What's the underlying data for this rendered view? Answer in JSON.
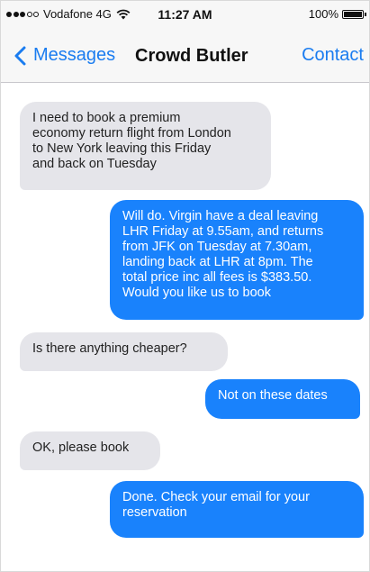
{
  "status_bar": {
    "carrier": "Vodafone 4G",
    "time": "11:27 AM",
    "battery": "100%"
  },
  "nav": {
    "back_label": "Messages",
    "title": "Crowd Butler",
    "contact_label": "Contact"
  },
  "messages": [
    {
      "direction": "received",
      "text": "I need to book a premium\neconomy return flight from London\nto New York leaving this Friday\nand back on Tuesday"
    },
    {
      "direction": "sent",
      "text": "Will do. Virgin have a deal leaving\nLHR Friday at 9.55am, and returns\nfrom JFK on Tuesday at 7.30am,\nlanding back at LHR at 8pm. The\ntotal price inc all fees is $383.50.\nWould you like us to book"
    },
    {
      "direction": "received",
      "text": "Is there anything cheaper?"
    },
    {
      "direction": "sent",
      "text": "Not on these dates"
    },
    {
      "direction": "received",
      "text": "OK, please book"
    },
    {
      "direction": "sent",
      "text": "Done. Check your email for your\nreservation"
    }
  ],
  "colors": {
    "accent": "#1a7cf0",
    "sent_bubble": "#1982fc",
    "received_bubble": "#e5e5ea"
  }
}
